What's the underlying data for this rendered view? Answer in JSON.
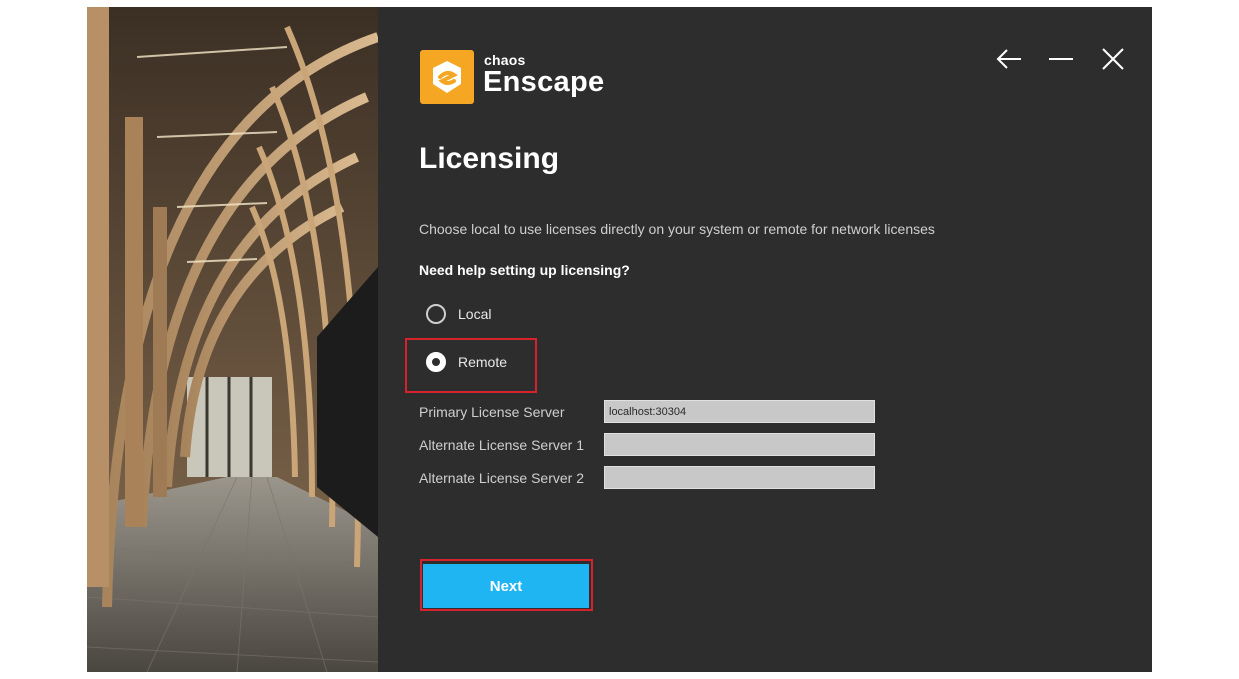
{
  "brand": {
    "company": "chaos",
    "product": "Enscape",
    "logo_color": "#f5a623"
  },
  "window_controls": {
    "back_icon": "arrow-left-icon",
    "minimize_icon": "minimize-icon",
    "close_icon": "close-icon"
  },
  "page": {
    "title": "Licensing",
    "description": "Choose local to use licenses directly on your system or remote for network licenses",
    "help_link": "Need help setting up licensing?"
  },
  "license_mode": {
    "options": [
      {
        "label": "Local",
        "selected": false
      },
      {
        "label": "Remote",
        "selected": true
      }
    ]
  },
  "servers": {
    "primary_label": "Primary License Server",
    "primary_value": "localhost:30304",
    "alternate1_label": "Alternate License Server 1",
    "alternate1_value": "",
    "alternate2_label": "Alternate License Server 2",
    "alternate2_value": ""
  },
  "actions": {
    "next_label": "Next",
    "next_color": "#1fb4f2",
    "highlight_color": "#d6222a"
  }
}
